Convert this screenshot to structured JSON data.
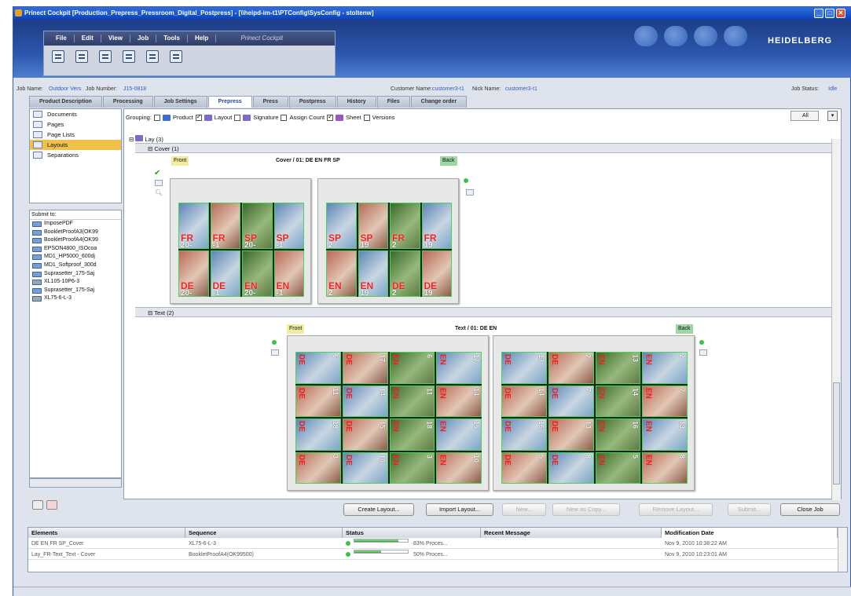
{
  "window": {
    "title": "Prinect Cockpit [Production_Prepress_Pressroom_Digital_Postpress] - [\\\\heipd-im-t1\\PTConfig\\SysConfig - stoltenw]",
    "min": "_",
    "max": "□",
    "close": "✕"
  },
  "menu": [
    "File",
    "Edit",
    "View",
    "Job",
    "Tools",
    "Help"
  ],
  "brand": "Prinect Cockpit",
  "logo": "HEIDELBERG",
  "job": {
    "name_label": "Job Name:",
    "name": "Outdoor Vers",
    "number_label": "Job Number:",
    "number": "J15-0818",
    "customer_label": "Customer Name:",
    "customer": "customer3-t1",
    "nick_label": "Nick Name:",
    "nick": "customer3-t1",
    "status_label": "Job Status:",
    "status": "Idle"
  },
  "tabs": [
    "Product Description",
    "Processing",
    "Job Settings",
    "Prepress",
    "Press",
    "Postpress",
    "History",
    "Files",
    "Change order"
  ],
  "nav": [
    "Documents",
    "Pages",
    "Page Lists",
    "Layouts",
    "Separations"
  ],
  "submit_title": "Submit to:",
  "submit": [
    "ImposePDF",
    "BookletProofA3(OK99",
    "BookletProofA4(OK99",
    "EPSON4800_ISOcoa",
    "MD1_HP5000_600dj",
    "MD1_Softproof_300d",
    "Suprasetter_175-Saj",
    "XL105-10P6-3",
    "Suprasetter_175-Saj",
    "XL75-6-L-3"
  ],
  "grouping": {
    "label": "Grouping:",
    "items": [
      "Product",
      "Layout",
      "Signature",
      "Assign Count",
      "Sheet",
      "Versions"
    ],
    "all": "All"
  },
  "tree": {
    "lay": "Lay (3)",
    "cover": "Cover (1)",
    "text": "Text (2)"
  },
  "cover": {
    "front": "Front",
    "back": "Back",
    "title": "Cover / 01: DE EN FR SP",
    "front_pages": [
      [
        "FR",
        "20-"
      ],
      [
        "FR",
        "-1"
      ],
      [
        "SP",
        "20-"
      ],
      [
        "SP",
        "-1"
      ],
      [
        "DE",
        "20-"
      ],
      [
        "DE",
        "-1"
      ],
      [
        "EN",
        "20-"
      ],
      [
        "EN",
        "-1"
      ]
    ],
    "back_pages": [
      [
        "SP",
        "2"
      ],
      [
        "SP",
        "19"
      ],
      [
        "FR",
        "2"
      ],
      [
        "FR",
        "19"
      ],
      [
        "EN",
        "2"
      ],
      [
        "EN",
        "19"
      ],
      [
        "DE",
        "2"
      ],
      [
        "DE",
        "19"
      ]
    ]
  },
  "text": {
    "front": "Front",
    "back": "Back",
    "title": "Text / 01: DE EN",
    "front_pages": [
      [
        "DE",
        "6"
      ],
      [
        "DE",
        "17"
      ],
      [
        "EN",
        "6"
      ],
      [
        "EN",
        "17"
      ],
      [
        "DE",
        "11"
      ],
      [
        "DE",
        "14"
      ],
      [
        "EN",
        "11"
      ],
      [
        "EN",
        "14"
      ],
      [
        "DE",
        "18"
      ],
      [
        "DE",
        "15"
      ],
      [
        "EN",
        "18"
      ],
      [
        "EN",
        "15"
      ],
      [
        "DE",
        "3"
      ],
      [
        "DE",
        "10"
      ],
      [
        "EN",
        "3"
      ],
      [
        "EN",
        "10"
      ]
    ],
    "back_pages": [
      [
        "DE",
        "13"
      ],
      [
        "DE",
        "2"
      ],
      [
        "EN",
        "13"
      ],
      [
        "EN",
        "2"
      ],
      [
        "DE",
        "14"
      ],
      [
        "DE",
        "7"
      ],
      [
        "EN",
        "14"
      ],
      [
        "EN",
        "7"
      ],
      [
        "DE",
        "16"
      ],
      [
        "DE",
        "13"
      ],
      [
        "EN",
        "16"
      ],
      [
        "EN",
        "13"
      ],
      [
        "DE",
        "5"
      ],
      [
        "DE",
        "8"
      ],
      [
        "EN",
        "5"
      ],
      [
        "EN",
        "8"
      ]
    ]
  },
  "buttons": {
    "create": "Create Layout...",
    "import": "Import Layout...",
    "new": "New...",
    "new_copy": "New as Copy...",
    "remove": "Remove Layout...",
    "submit": "Submit...",
    "close": "Close Job"
  },
  "table": {
    "headers": [
      "Elements",
      "Sequence",
      "Status",
      "Recent Message",
      "Modification Date"
    ],
    "rows": [
      {
        "element": "DE EN FR SP_Cover",
        "sequence": "XL75-6-L-3",
        "progress": 0.83,
        "status": "83% Proces...",
        "message": "",
        "date": "Nov 9, 2010 10:38:22 AM"
      },
      {
        "element": "Lay_FR-Text_Text - Cover",
        "sequence": "BookletProofA4(OK99500)",
        "progress": 0.5,
        "status": "50% Proces...",
        "message": "",
        "date": "Nov 9, 2010 10:23:01 AM"
      }
    ]
  }
}
